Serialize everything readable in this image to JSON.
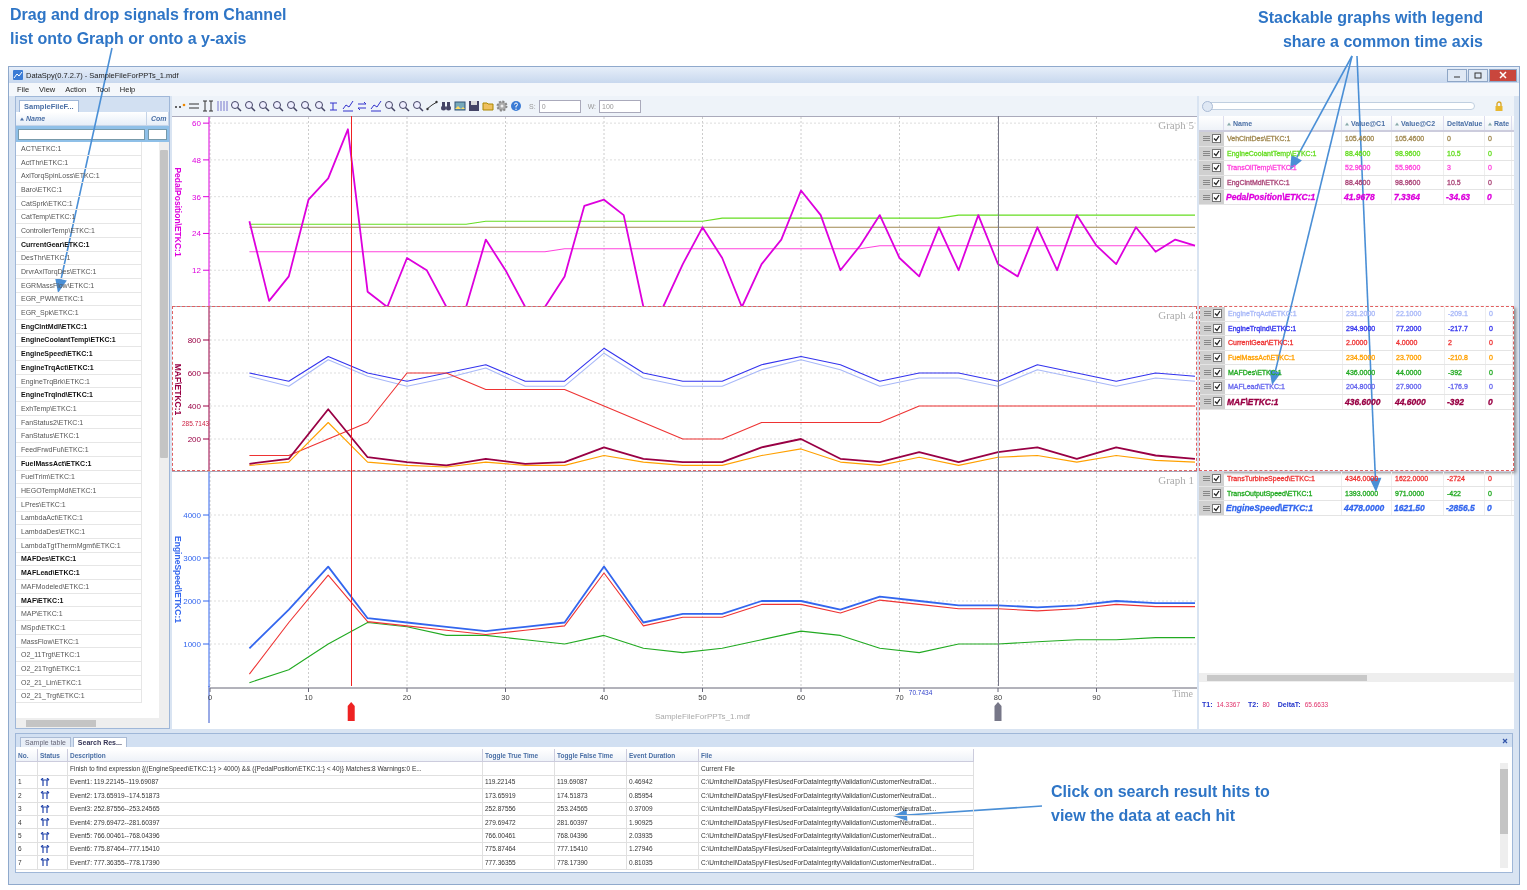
{
  "callouts": [
    {
      "kind": "channels",
      "lines": [
        "Drag and drop signals from Channel",
        "list onto Graph or onto a y-axis"
      ]
    },
    {
      "kind": "graphs",
      "lines": [
        "Stackable graphs with legend",
        "share a common time axis"
      ]
    },
    {
      "kind": "search",
      "lines": [
        "Click on search result hits to",
        "view the data at each hit"
      ]
    }
  ],
  "window": {
    "title": "DataSpy(0.7.2.7) - SampleFileForPPTs_1.mdf"
  },
  "menu": [
    "File",
    "View",
    "Action",
    "Tool",
    "Help"
  ],
  "channel_panel": {
    "tabs": [
      {
        "label": "SampleFileF...",
        "selected": true
      }
    ],
    "columns": [
      "Name",
      "Com"
    ],
    "items": [
      {
        "name": "ACT\\ETKC:1",
        "in_graph": false
      },
      {
        "name": "ActThr\\ETKC:1",
        "in_graph": false
      },
      {
        "name": "AxlTorqSpinLoss\\ETKC:1",
        "in_graph": false
      },
      {
        "name": "Baro\\ETKC:1",
        "in_graph": false
      },
      {
        "name": "CatSprk\\ETKC:1",
        "in_graph": false
      },
      {
        "name": "CatTemp\\ETKC:1",
        "in_graph": false
      },
      {
        "name": "ControllerTemp\\ETKC:1",
        "in_graph": false
      },
      {
        "name": "CurrentGear\\ETKC:1",
        "in_graph": true
      },
      {
        "name": "DesThr\\ETKC:1",
        "in_graph": false
      },
      {
        "name": "DrvrAxlTorqDes\\ETKC:1",
        "in_graph": false
      },
      {
        "name": "EGRMassFlow\\ETKC:1",
        "in_graph": false
      },
      {
        "name": "EGR_PWM\\ETKC:1",
        "in_graph": false
      },
      {
        "name": "EGR_Spk\\ETKC:1",
        "in_graph": false
      },
      {
        "name": "EngClntMdl\\ETKC:1",
        "in_graph": true
      },
      {
        "name": "EngineCoolantTemp\\ETKC:1",
        "in_graph": true
      },
      {
        "name": "EngineSpeed\\ETKC:1",
        "in_graph": true
      },
      {
        "name": "EngineTrqAct\\ETKC:1",
        "in_graph": true
      },
      {
        "name": "EngineTrqBrk\\ETKC:1",
        "in_graph": false
      },
      {
        "name": "EngineTrqInd\\ETKC:1",
        "in_graph": true
      },
      {
        "name": "ExhTemp\\ETKC:1",
        "in_graph": false
      },
      {
        "name": "FanStatus2\\ETKC:1",
        "in_graph": false
      },
      {
        "name": "FanStatus\\ETKC:1",
        "in_graph": false
      },
      {
        "name": "FeedFrwdFul\\ETKC:1",
        "in_graph": false
      },
      {
        "name": "FuelMassAct\\ETKC:1",
        "in_graph": true
      },
      {
        "name": "FuelTrim\\ETKC:1",
        "in_graph": false
      },
      {
        "name": "HEGOTempMdl\\ETKC:1",
        "in_graph": false
      },
      {
        "name": "LPres\\ETKC:1",
        "in_graph": false
      },
      {
        "name": "LambdaAct\\ETKC:1",
        "in_graph": false
      },
      {
        "name": "LambdaDes\\ETKC:1",
        "in_graph": false
      },
      {
        "name": "LambdaTgtThermMgmt\\ETKC:1",
        "in_graph": false
      },
      {
        "name": "MAFDes\\ETKC:1",
        "in_graph": true
      },
      {
        "name": "MAFLead\\ETKC:1",
        "in_graph": true
      },
      {
        "name": "MAFModeled\\ETKC:1",
        "in_graph": false
      },
      {
        "name": "MAF\\ETKC:1",
        "in_graph": true
      },
      {
        "name": "MAP\\ETKC:1",
        "in_graph": false
      },
      {
        "name": "MSpd\\ETKC:1",
        "in_graph": false
      },
      {
        "name": "MassFlow\\ETKC:1",
        "in_graph": false
      },
      {
        "name": "O2_11Trgt\\ETKC:1",
        "in_graph": false
      },
      {
        "name": "O2_21Trgt\\ETKC:1",
        "in_graph": false
      },
      {
        "name": "O2_21_Lin\\ETKC:1",
        "in_graph": false
      },
      {
        "name": "O2_21_Trgt\\ETKC:1",
        "in_graph": false
      }
    ]
  },
  "toolbar": {
    "fields": [
      {
        "label": "S:",
        "value": "0"
      },
      {
        "label": "W:",
        "value": "100"
      }
    ]
  },
  "legend": {
    "range_slider": {
      "level": 0
    },
    "columns": [
      "Name",
      "Value@C1",
      "Value@C2",
      "DeltaValue",
      "Rate"
    ]
  },
  "graphs": [
    {
      "title": "Graph 5",
      "selected": false,
      "y_label": "PedalPosition\\ETKC:1",
      "legend": [
        {
          "name": "VehClntDes\\ETKC:1",
          "c1": "105.4600",
          "c2": "105.4600",
          "delta": "0",
          "rate": "0",
          "color": "#a08850",
          "checked": true,
          "kind": "signal"
        },
        {
          "name": "EngineCoolantTemp\\ETKC:1",
          "c1": "88.4600",
          "c2": "98.9600",
          "delta": "10.5",
          "rate": "0",
          "color": "#66dd22",
          "checked": true,
          "kind": "signal"
        },
        {
          "name": "TransOilTemp\\ETKC:1",
          "c1": "52.9600",
          "c2": "55.9600",
          "delta": "3",
          "rate": "0",
          "color": "#ff44dd",
          "checked": true,
          "kind": "signal"
        },
        {
          "name": "EngClntMdl\\ETKC:1",
          "c1": "88.4600",
          "c2": "98.9600",
          "delta": "10.5",
          "rate": "0",
          "color": "#aa4477",
          "checked": true,
          "kind": "signal"
        },
        {
          "name": "PedalPosition\\ETKC:1",
          "c1": "41.9678",
          "c2": "7.3364",
          "delta": "-34.63",
          "rate": "0",
          "color": "#dd00dd",
          "checked": true,
          "kind": "axis"
        }
      ],
      "chart_data": {
        "type": "line",
        "grid": true,
        "ylim": [
          0,
          62
        ],
        "yticks": [
          12,
          24,
          36,
          48,
          60
        ],
        "categories": [
          null,
          null,
          null,
          null,
          null,
          null,
          null,
          null,
          null,
          null,
          null,
          null,
          null,
          null,
          null,
          null,
          null,
          null,
          null,
          null,
          null,
          null,
          null,
          null,
          null,
          null,
          null,
          null,
          null,
          null,
          null,
          null,
          null,
          null,
          null,
          null,
          null,
          null,
          null,
          null,
          null,
          null,
          null,
          null,
          null,
          null,
          null,
          null,
          null,
          null,
          null
        ],
        "series": [
          {
            "color": "#a08850",
            "values": [
              null,
              null,
              26,
              26,
              26,
              26,
              26,
              26,
              26,
              26,
              26,
              26,
              26,
              26,
              26,
              26,
              26,
              26,
              26,
              26,
              26,
              26,
              26,
              26,
              26,
              26,
              26,
              26,
              26,
              26,
              26,
              26,
              26,
              26,
              26,
              26,
              26,
              26,
              26,
              26,
              26,
              26,
              26,
              26,
              26,
              26,
              26,
              26,
              26,
              26,
              26
            ]
          },
          {
            "color": "#66dd22",
            "values": [
              null,
              null,
              27,
              27,
              27,
              27,
              27,
              27,
              27,
              27,
              27,
              27,
              27,
              27,
              28,
              28,
              28,
              28,
              28,
              28,
              28,
              28,
              28,
              28,
              28,
              28,
              29,
              29,
              29,
              29,
              29,
              29,
              29,
              29,
              29,
              29,
              29,
              29,
              30,
              30,
              30,
              30,
              30,
              30,
              30,
              30,
              30,
              30,
              30,
              30,
              30
            ]
          },
          {
            "color": "#ff44dd",
            "values": [
              null,
              null,
              18,
              18,
              18,
              18,
              18,
              18,
              18,
              18,
              18,
              18,
              18,
              18,
              18,
              18,
              18,
              18,
              19,
              19,
              19,
              19,
              19,
              19,
              19,
              19,
              19,
              19,
              19,
              19,
              19,
              19,
              19,
              19,
              20,
              20,
              20,
              20,
              20,
              20,
              20,
              20,
              20,
              20,
              20,
              20,
              20,
              20,
              20,
              20,
              20
            ]
          },
          {
            "color": "#dd00dd",
            "values": [
              null,
              null,
              28,
              2,
              10,
              35,
              42,
              58,
              5,
              0,
              16,
              12,
              0,
              0,
              22,
              12,
              0,
              0,
              10,
              33,
              35,
              30,
              0,
              0,
              14,
              26,
              16,
              0,
              14,
              22,
              38,
              30,
              12,
              20,
              30,
              16,
              10,
              26,
              12,
              30,
              14,
              10,
              26,
              12,
              30,
              20,
              14,
              26,
              18,
              22,
              20
            ]
          }
        ]
      }
    },
    {
      "title": "Graph 4",
      "selected": true,
      "y_label": "MAF\\ETKC:1",
      "axis_readout": "285.7143",
      "legend": [
        {
          "name": "EngineTrqAct\\ETKC:1",
          "c1": "231.2000",
          "c2": "22.1000",
          "delta": "-209.1",
          "rate": "0",
          "color": "#a8b8f8",
          "checked": true,
          "kind": "signal"
        },
        {
          "name": "EngineTrqInd\\ETKC:1",
          "c1": "294.9000",
          "c2": "77.2000",
          "delta": "-217.7",
          "rate": "0",
          "color": "#3333ee",
          "checked": true,
          "kind": "signal"
        },
        {
          "name": "CurrentGear\\ETKC:1",
          "c1": "2.0000",
          "c2": "4.0000",
          "delta": "2",
          "rate": "0",
          "color": "#ee3333",
          "checked": true,
          "kind": "signal"
        },
        {
          "name": "FuelMassAct\\ETKC:1",
          "c1": "234.5000",
          "c2": "23.7000",
          "delta": "-210.8",
          "rate": "0",
          "color": "#ffa000",
          "checked": true,
          "kind": "signal"
        },
        {
          "name": "MAFDes\\ETKC:1",
          "c1": "436.0000",
          "c2": "44.0000",
          "delta": "-392",
          "rate": "0",
          "color": "#22aa22",
          "checked": true,
          "kind": "signal"
        },
        {
          "name": "MAFLead\\ETKC:1",
          "c1": "204.8000",
          "c2": "27.9000",
          "delta": "-176.9",
          "rate": "0",
          "color": "#6666ee",
          "checked": true,
          "kind": "signal"
        },
        {
          "name": "MAF\\ETKC:1",
          "c1": "436.6000",
          "c2": "44.6000",
          "delta": "-392",
          "rate": "0",
          "color": "#990044",
          "checked": true,
          "kind": "axis"
        }
      ],
      "chart_data": {
        "type": "line",
        "grid": true,
        "ylim": [
          0,
          1000
        ],
        "yticks": [
          200,
          400,
          600,
          800
        ],
        "categories": [
          null,
          null,
          null,
          null,
          null,
          null,
          null,
          null,
          null,
          null,
          null,
          null,
          null,
          null,
          null,
          null,
          null,
          null,
          null,
          null,
          null,
          null,
          null,
          null,
          null,
          null
        ],
        "series": [
          {
            "color": "#a8b8f8",
            "values": [
              null,
              580,
              520,
              680,
              580,
              520,
              570,
              630,
              520,
              520,
              720,
              570,
              520,
              520,
              620,
              680,
              620,
              520,
              570,
              570,
              520,
              620,
              570,
              520,
              570,
              550
            ]
          },
          {
            "color": "#3333ee",
            "values": [
              null,
              600,
              550,
              700,
              600,
              550,
              600,
              650,
              550,
              550,
              750,
              600,
              550,
              550,
              650,
              700,
              650,
              550,
              600,
              600,
              550,
              650,
              600,
              550,
              600,
              580
            ]
          },
          {
            "color": "#ee3333",
            "values": [
              null,
              100,
              100,
              200,
              300,
              600,
              600,
              500,
              500,
              500,
              400,
              300,
              200,
              200,
              300,
              300,
              300,
              300,
              400,
              400,
              400,
              400,
              400,
              400,
              400,
              400
            ]
          },
          {
            "color": "#ffa000",
            "values": [
              null,
              40,
              60,
              300,
              60,
              40,
              30,
              60,
              40,
              40,
              100,
              60,
              40,
              40,
              100,
              140,
              60,
              40,
              90,
              40,
              90,
              100,
              60,
              100,
              70,
              60
            ]
          },
          {
            "color": "#990044",
            "values": [
              null,
              50,
              80,
              380,
              90,
              60,
              40,
              80,
              50,
              60,
              150,
              80,
              60,
              60,
              150,
              200,
              80,
              60,
              120,
              60,
              120,
              150,
              80,
              150,
              100,
              80
            ]
          }
        ]
      }
    },
    {
      "title": "Graph 1",
      "selected": false,
      "y_label": "EngineSpeed\\ETKC:1",
      "legend": [
        {
          "name": "TransTurbineSpeed\\ETKC:1",
          "c1": "4346.0000",
          "c2": "1622.0000",
          "delta": "-2724",
          "rate": "0",
          "color": "#ee3333",
          "checked": true,
          "kind": "signal"
        },
        {
          "name": "TransOutputSpeed\\ETKC:1",
          "c1": "1393.0000",
          "c2": "971.0000",
          "delta": "-422",
          "rate": "0",
          "color": "#22aa22",
          "checked": true,
          "kind": "signal"
        },
        {
          "name": "EngineSpeed\\ETKC:1",
          "c1": "4478.0000",
          "c2": "1621.50",
          "delta": "-2856.5",
          "rate": "0",
          "color": "#3366ee",
          "checked": true,
          "kind": "axis"
        }
      ],
      "chart_data": {
        "type": "line",
        "grid": true,
        "xlim": [
          0,
          100
        ],
        "ylim": [
          0,
          5000
        ],
        "yticks": [
          1000,
          2000,
          3000,
          4000
        ],
        "xticks": [
          0,
          10,
          20,
          30,
          40,
          50,
          60,
          70,
          80,
          90
        ],
        "x": [
          4,
          8,
          12,
          16,
          20,
          24,
          28,
          32,
          36,
          40,
          44,
          48,
          52,
          56,
          60,
          64,
          68,
          72,
          76,
          80,
          84,
          88,
          92,
          96,
          100
        ],
        "series": [
          {
            "color": "#22aa22",
            "values": [
              100,
              400,
              1000,
              1500,
              1400,
              1200,
              1200,
              1100,
              1000,
              1200,
              900,
              800,
              900,
              1100,
              1300,
              1200,
              900,
              800,
              1000,
              1000,
              1050,
              1100,
              1100,
              1150,
              1150
            ]
          },
          {
            "color": "#ee3333",
            "values": [
              300,
              1500,
              2600,
              1520,
              1420,
              1320,
              1220,
              1320,
              1420,
              2650,
              1420,
              1620,
              1620,
              1920,
              1920,
              1720,
              2020,
              1920,
              1820,
              1820,
              1770,
              1820,
              1920,
              1870,
              1870
            ]
          },
          {
            "color": "#3366ee",
            "values": [
              900,
              1800,
              2800,
              1600,
              1500,
              1400,
              1300,
              1400,
              1500,
              2800,
              1500,
              1700,
              1700,
              2000,
              2000,
              1800,
              2100,
              2000,
              1900,
              1900,
              1850,
              1900,
              2000,
              1950,
              1950
            ]
          }
        ]
      }
    }
  ],
  "x_axis": {
    "label": "Time",
    "file": "SampleFileForPPTs_1.mdf",
    "marker_label": "70.7434",
    "cursors": [
      {
        "label": "T1:",
        "value": "14.3367",
        "color": "#ee2222"
      },
      {
        "label": "T2:",
        "value": "80",
        "color": "#777788"
      }
    ],
    "delta": {
      "label": "DeltaT:",
      "value": "65.6633"
    }
  },
  "bottom_panel": {
    "tabs": [
      {
        "label": "Sample table",
        "selected": false
      },
      {
        "label": "Search Res...",
        "selected": true
      }
    ],
    "columns": [
      "No.",
      "Status",
      "Description",
      "Toggle True Time",
      "Toggle False Time",
      "Event Duration",
      "File"
    ],
    "rows": [
      {
        "kind": "summary",
        "description": "Finish to find expression {((EngineSpeed\\ETKC:1:} > 4000) && ({PedalPosition\\ETKC:1:} < 40)} Matches:8 Warnings:0 E...",
        "file": "Current File"
      },
      {
        "kind": "event",
        "no": "1",
        "description": "Event1: 119.22145--119.69087",
        "true_time": "119.22145",
        "false_time": "119.69087",
        "duration": "0.46942",
        "file": "C:\\Umitchell\\DataSpy\\FilesUsedForDataIntegrity\\Validation\\CustomerNeutralDat..."
      },
      {
        "kind": "event",
        "no": "2",
        "description": "Event2: 173.65919--174.51873",
        "true_time": "173.65919",
        "false_time": "174.51873",
        "duration": "0.85954",
        "file": "C:\\Umitchell\\DataSpy\\FilesUsedForDataIntegrity\\Validation\\CustomerNeutralDat..."
      },
      {
        "kind": "event",
        "no": "3",
        "description": "Event3: 252.87556--253.24565",
        "true_time": "252.87556",
        "false_time": "253.24565",
        "duration": "0.37009",
        "file": "C:\\Umitchell\\DataSpy\\FilesUsedForDataIntegrity\\Validation\\CustomerNeutralDat..."
      },
      {
        "kind": "event",
        "no": "4",
        "description": "Event4: 279.69472--281.60397",
        "true_time": "279.69472",
        "false_time": "281.60397",
        "duration": "1.90925",
        "file": "C:\\Umitchell\\DataSpy\\FilesUsedForDataIntegrity\\Validation\\CustomerNeutralDat..."
      },
      {
        "kind": "event",
        "no": "5",
        "description": "Event5: 766.00461--768.04396",
        "true_time": "766.00461",
        "false_time": "768.04396",
        "duration": "2.03935",
        "file": "C:\\Umitchell\\DataSpy\\FilesUsedForDataIntegrity\\Validation\\CustomerNeutralDat..."
      },
      {
        "kind": "event",
        "no": "6",
        "description": "Event6: 775.87464--777.15410",
        "true_time": "775.87464",
        "false_time": "777.15410",
        "duration": "1.27946",
        "file": "C:\\Umitchell\\DataSpy\\FilesUsedForDataIntegrity\\Validation\\CustomerNeutralDat..."
      },
      {
        "kind": "event",
        "no": "7",
        "description": "Event7: 777.36355--778.17390",
        "true_time": "777.36355",
        "false_time": "778.17390",
        "duration": "0.81035",
        "file": "C:\\Umitchell\\DataSpy\\FilesUsedForDataIntegrity\\Validation\\CustomerNeutralDat..."
      }
    ]
  }
}
